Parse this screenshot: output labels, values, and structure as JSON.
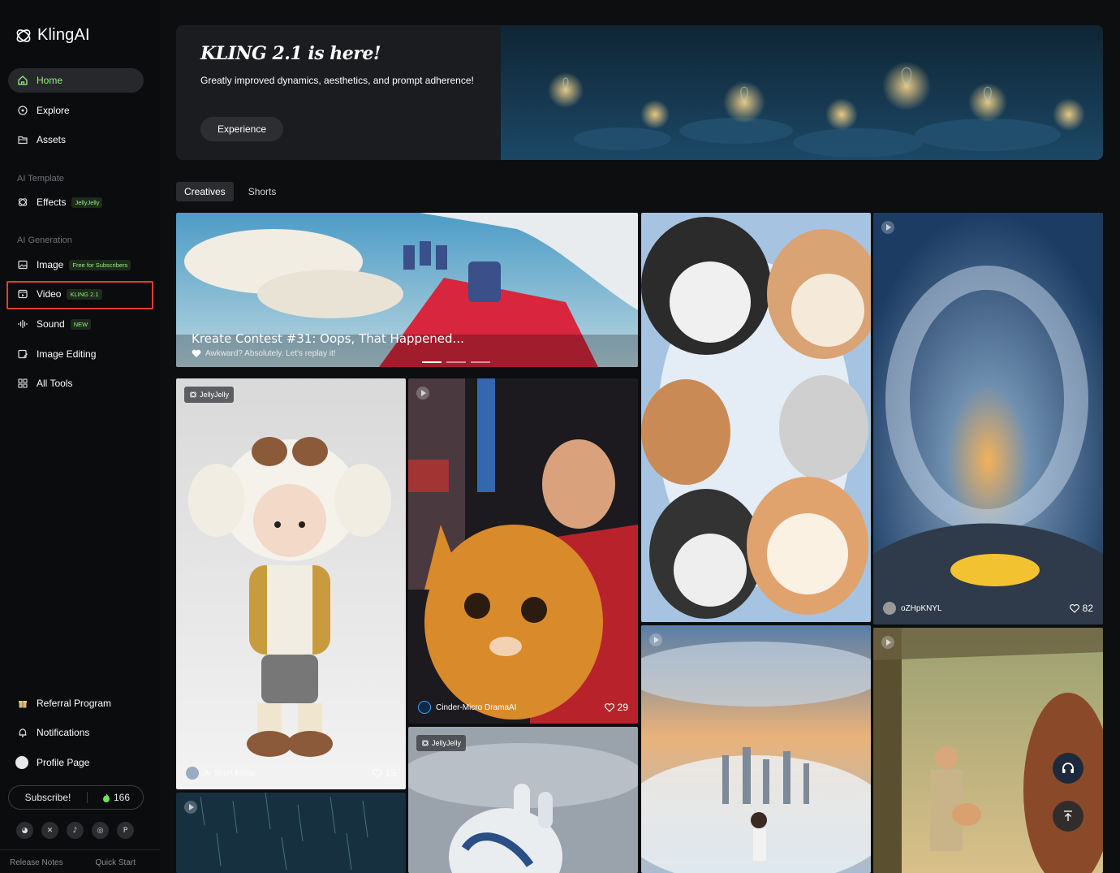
{
  "brand": {
    "name": "KlingAI"
  },
  "nav": {
    "home": "Home",
    "explore": "Explore",
    "assets": "Assets",
    "ai_template_label": "AI Template",
    "effects": "Effects",
    "effects_badge": "JellyJelly",
    "ai_generation_label": "AI Generation",
    "image": "Image",
    "image_badge": "Free for Subscribers",
    "video": "Video",
    "video_badge": "KLING 2.1",
    "sound": "Sound",
    "sound_badge": "NEW",
    "image_editing": "Image Editing",
    "all_tools": "All Tools",
    "referral": "Referral Program",
    "notifications": "Notifications",
    "profile": "Profile Page"
  },
  "subscribe": {
    "label": "Subscribe!",
    "credits": "166"
  },
  "social": [
    "discord-icon",
    "x-icon",
    "tiktok-icon",
    "instagram-icon",
    "pinterest-icon"
  ],
  "footer": {
    "release_notes": "Release Notes",
    "quick_start": "Quick Start"
  },
  "banner": {
    "title": "KLING 2.1 is here!",
    "subtitle": "Greatly improved dynamics, aesthetics, and prompt adherence!",
    "button": "Experience"
  },
  "tabs": [
    "Creatives",
    "Shorts"
  ],
  "contest": {
    "title": "Kreate Contest #31: Oops, That Happened...",
    "subtitle": "Awkward? Absolutely. Let's replay it!"
  },
  "cards": {
    "doll": {
      "tag": "JellyJelly",
      "author": "AI Short Films",
      "likes": "15"
    },
    "cat_street": {
      "author": "Cinder-Micro DramaAI",
      "likes": "29"
    },
    "heart": {
      "tag": "JellyJelly"
    },
    "fisheye": {
      "author": "oZHpKNYL",
      "likes": "82"
    }
  },
  "colors": {
    "accent": "#8ef27a",
    "highlight": "#e53b3b"
  }
}
